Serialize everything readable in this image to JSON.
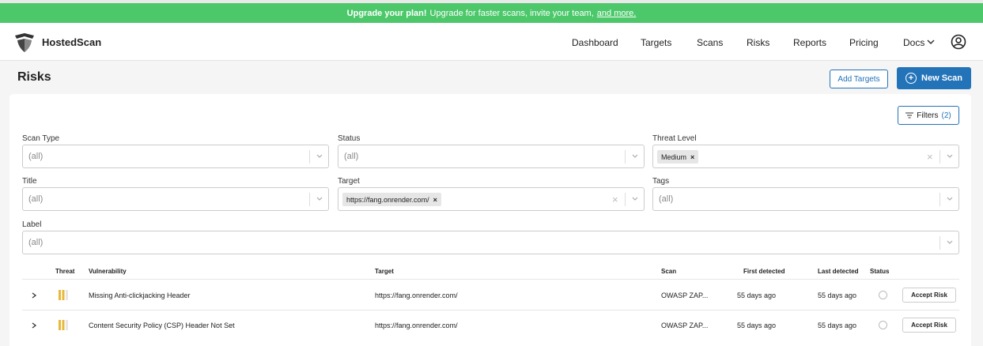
{
  "banner": {
    "bold": "Upgrade your plan!",
    "text": "Upgrade for faster scans, invite your team,",
    "link": "and more."
  },
  "nav": {
    "brand": "HostedScan",
    "links": [
      "Dashboard",
      "Targets",
      "Scans",
      "Risks",
      "Reports",
      "Pricing",
      "Docs"
    ]
  },
  "page": {
    "title": "Risks",
    "add_targets": "Add Targets",
    "new_scan": "New Scan",
    "filters_label": "Filters",
    "filters_count": "(2)"
  },
  "filters": {
    "scan_type": {
      "label": "Scan Type",
      "placeholder": "(all)"
    },
    "status": {
      "label": "Status",
      "placeholder": "(all)"
    },
    "threat_level": {
      "label": "Threat Level",
      "chip": "Medium"
    },
    "title": {
      "label": "Title",
      "placeholder": "(all)"
    },
    "target": {
      "label": "Target",
      "chip": "https://fang.onrender.com/"
    },
    "tags": {
      "label": "Tags",
      "placeholder": "(all)"
    },
    "label": {
      "label": "Label",
      "placeholder": "(all)"
    }
  },
  "table": {
    "headers": {
      "threat": "Threat",
      "vulnerability": "Vulnerability",
      "target": "Target",
      "scan": "Scan",
      "first_detected": "First detected",
      "last_detected": "Last detected",
      "status": "Status"
    },
    "rows": [
      {
        "vulnerability": "Missing Anti-clickjacking Header",
        "target": "https://fang.onrender.com/",
        "scan": "OWASP ZAP...",
        "first_detected": "55 days ago",
        "last_detected": "55 days ago",
        "action": "Accept Risk",
        "threat_level": "medium"
      },
      {
        "vulnerability": "Content Security Policy (CSP) Header Not Set",
        "target": "https://fang.onrender.com/",
        "scan": "OWASP ZAP...",
        "first_detected": "55 days ago",
        "last_detected": "55 days ago",
        "action": "Accept Risk",
        "threat_level": "medium"
      }
    ]
  },
  "colors": {
    "banner": "#4cc86b",
    "primary": "#2373b9",
    "threat_medium": "#e8b83a"
  }
}
